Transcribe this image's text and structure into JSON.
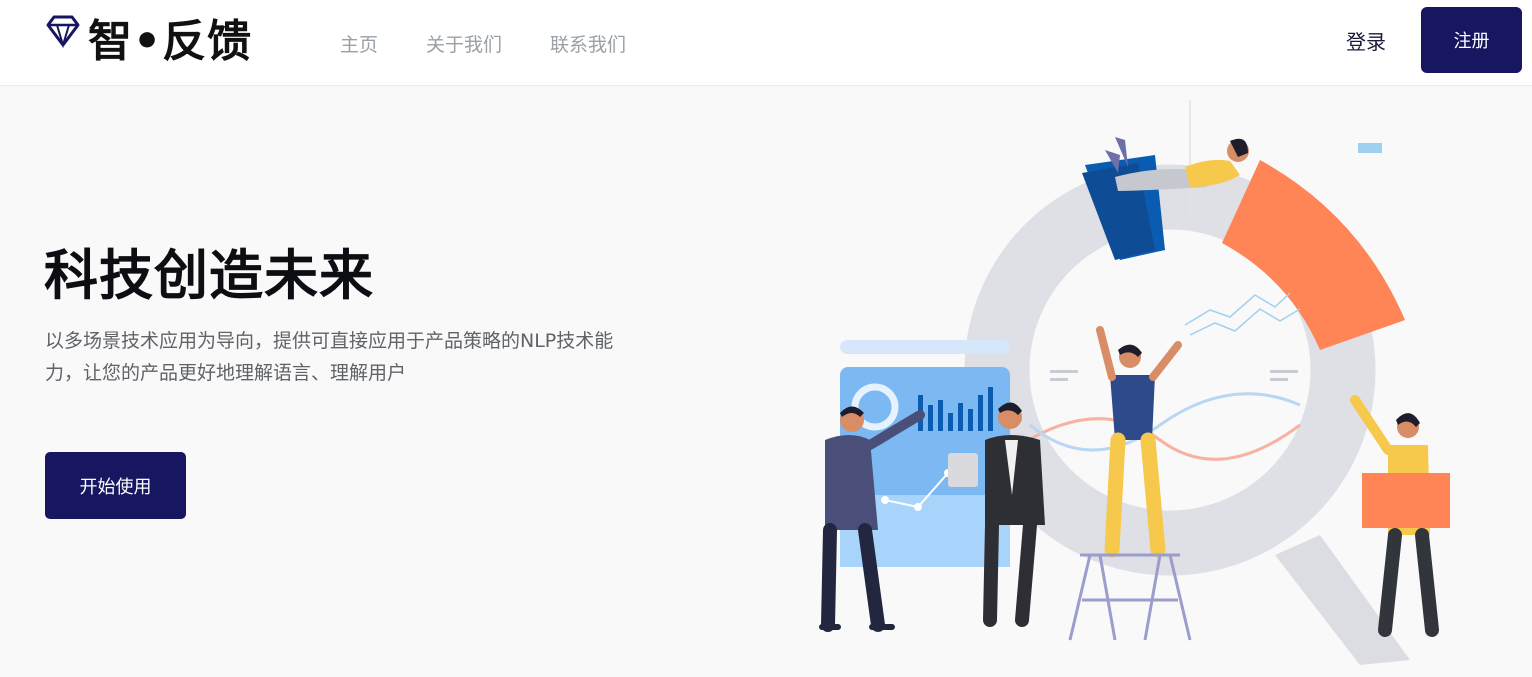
{
  "brand": {
    "name": "智•反馈",
    "logo_icon": "diamond-icon"
  },
  "nav": {
    "links": [
      {
        "label": "主页"
      },
      {
        "label": "关于我们"
      },
      {
        "label": "联系我们"
      }
    ],
    "login_label": "登录",
    "register_label": "注册"
  },
  "hero": {
    "title": "科技创造未来",
    "description": "以多场景技术应用为导向，提供可直接应用于产品策略的NLP技术能力，让您的产品更好地理解语言、理解用户",
    "cta_label": "开始使用"
  },
  "colors": {
    "primary": "#161661",
    "accent_orange": "#ff8456",
    "accent_blue": "#0a5cb0",
    "text_dark": "#0d0d14",
    "text_muted": "#5f6368",
    "nav_muted": "#9aa0a6"
  }
}
